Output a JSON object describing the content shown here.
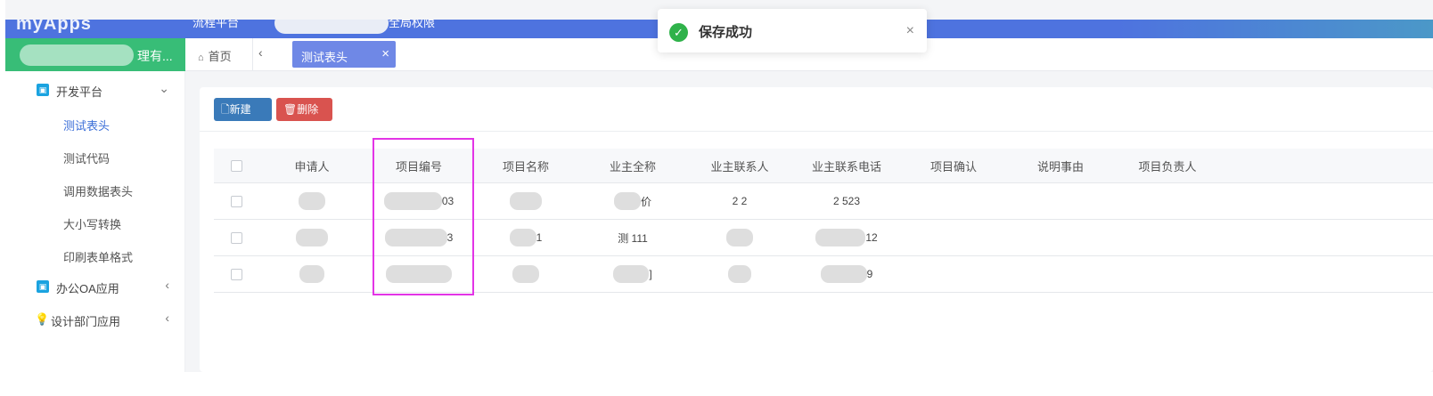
{
  "topbar": {
    "app_name": "myApps",
    "nav_left": "流程平台",
    "nav_right": "全局权限"
  },
  "brand": {
    "name": "理有..."
  },
  "sidebar": {
    "groups": [
      {
        "label": "开发平台",
        "icon": "cube-icon",
        "expanded": true
      },
      {
        "label": "办公OA应用",
        "icon": "cube-icon",
        "expanded": false
      },
      {
        "label": "设计部门应用",
        "icon": "lightbulb-icon",
        "expanded": false
      }
    ],
    "items": [
      {
        "label": "测试表头",
        "active": true
      },
      {
        "label": "测试代码"
      },
      {
        "label": "调用数据表头"
      },
      {
        "label": "大小写转换"
      },
      {
        "label": "印刷表单格式"
      }
    ]
  },
  "tabs": {
    "home": "首页",
    "active": "测试表头"
  },
  "toolbar": {
    "new_label": "新建",
    "delete_label": "删除"
  },
  "table": {
    "columns": [
      "申请人",
      "项目编号",
      "项目名称",
      "业主全称",
      "业主联系人",
      "业主联系电话",
      "项目确认",
      "说明事由",
      "项目负责人"
    ],
    "rows": [
      [
        "",
        "03",
        "",
        "价",
        "2    2",
        "2     523",
        "",
        "",
        ""
      ],
      [
        "",
        "3",
        "1",
        "测 111",
        "",
        "12",
        "",
        "",
        ""
      ],
      [
        "",
        "",
        "",
        "]",
        "",
        "9",
        "",
        "",
        ""
      ]
    ]
  },
  "toast": {
    "message": "保存成功",
    "status_color": "#2fb24a"
  },
  "colors": {
    "topbar": "#4e73df",
    "brand": "#38bd77",
    "active_tab": "#6f88e6",
    "new_button": "#3a7ab9",
    "delete_button": "#d9534f",
    "highlight": "#e334e6"
  }
}
